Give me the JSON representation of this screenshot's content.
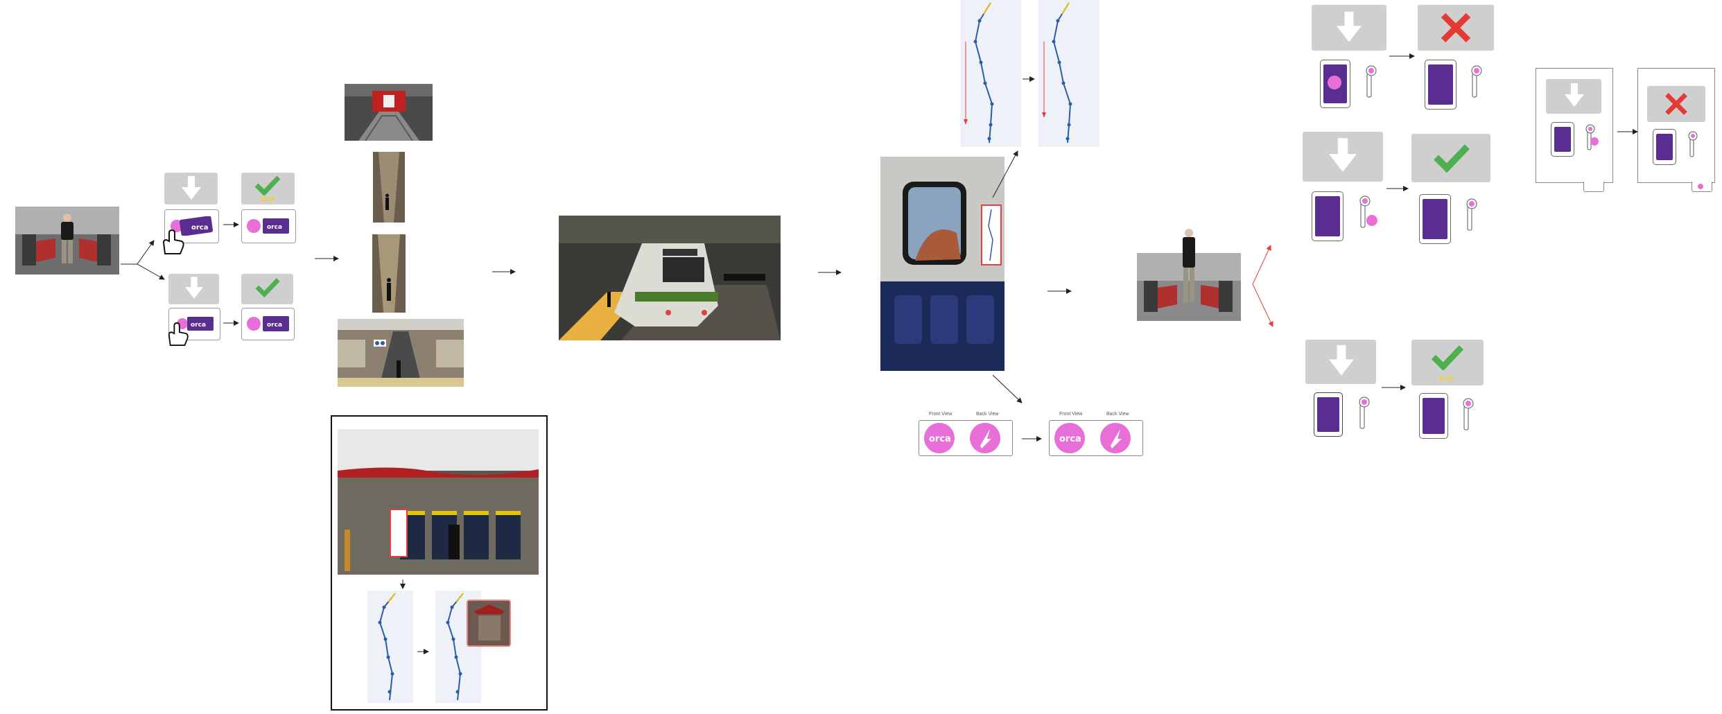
{
  "palette": {
    "panel_gray": "#cfcfcf",
    "check_green": "#4caf50",
    "cross_red": "#e53935",
    "orca_purple": "#5a2e91",
    "orca_pink": "#e86fd8",
    "route_blue": "#2b5ca8",
    "route_yellow": "#e8c400",
    "highlight_red": "#e04040",
    "arrow_black": "#222222"
  },
  "card_view_labels": {
    "front": "Front View",
    "back": "Back View"
  },
  "card_brand": "orca",
  "fares": {
    "panel_a": "$3.00",
    "panel_b": "$3.00"
  },
  "icons": [
    "down-arrow-icon",
    "check-icon",
    "cross-icon",
    "hand-tap-icon",
    "card-reader-icon",
    "phone-icon",
    "orca-card-icon",
    "link-arrow-icon"
  ]
}
